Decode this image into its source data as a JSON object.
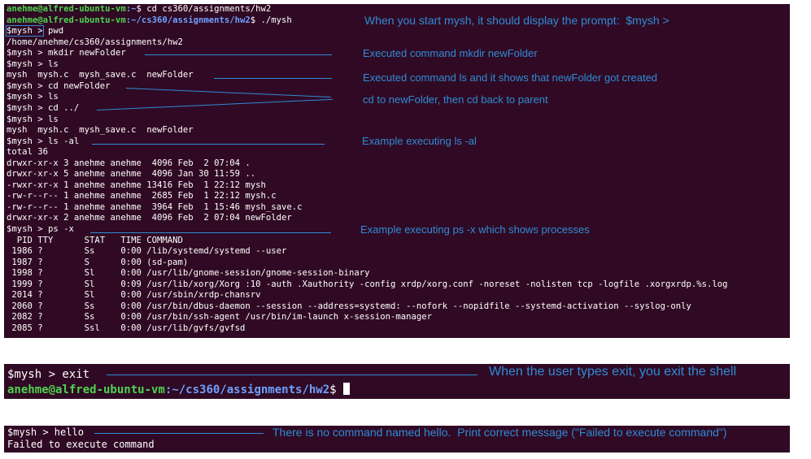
{
  "terminal1": {
    "title_user": "anehme@alfred-ubuntu-vm",
    "title_path": ":~",
    "title_cmd": "$ cd cs360/assignments/hw2",
    "line2_path": ":~/cs360/assignments/hw2",
    "line2_cmd": "$ ./mysh",
    "prompt": "$mysh >",
    "lines": [
      " pwd",
      "/home/anehme/cs360/assignments/hw2",
      "$mysh > mkdir newFolder",
      "$mysh > ls",
      "mysh  mysh.c  mysh_save.c  newFolder",
      "$mysh > cd newFolder",
      "$mysh > ls",
      "$mysh > cd ../",
      "$mysh > ls",
      "mysh  mysh.c  mysh_save.c  newFolder",
      "$mysh > ls -al",
      "total 36",
      "drwxr-xr-x 3 anehme anehme  4096 Feb  2 07:04 .",
      "drwxr-xr-x 5 anehme anehme  4096 Jan 30 11:59 ..",
      "-rwxr-xr-x 1 anehme anehme 13416 Feb  1 22:12 mysh",
      "-rw-r--r-- 1 anehme anehme  2685 Feb  1 22:12 mysh.c",
      "-rw-r--r-- 1 anehme anehme  3964 Feb  1 15:46 mysh_save.c",
      "drwxr-xr-x 2 anehme anehme  4096 Feb  2 07:04 newFolder",
      "$mysh > ps -x",
      "  PID TTY      STAT   TIME COMMAND",
      " 1986 ?        Ss     0:00 /lib/systemd/systemd --user",
      " 1987 ?        S      0:00 (sd-pam)",
      " 1998 ?        Sl     0:00 /usr/lib/gnome-session/gnome-session-binary",
      " 1999 ?        Sl     0:09 /usr/lib/xorg/Xorg :10 -auth .Xauthority -config xrdp/xorg.conf -noreset -nolisten tcp -logfile .xorgxrdp.%s.log",
      " 2014 ?        Sl     0:00 /usr/sbin/xrdp-chansrv",
      " 2060 ?        Ss     0:00 /usr/bin/dbus-daemon --session --address=systemd: --nofork --nopidfile --systemd-activation --syslog-only",
      " 2082 ?        Ss     0:00 /usr/bin/ssh-agent /usr/bin/im-launch x-session-manager",
      " 2085 ?        Ssl    0:00 /usr/lib/gvfs/gvfsd"
    ]
  },
  "annotations": {
    "prompt_note": "When you start mysh, it should display the prompt:  $mysh >",
    "mkdir_note": "Executed command mkdir newFolder",
    "ls_note": "Executed command ls and it shows that newFolder got created",
    "cd_note": "cd to newFolder, then cd back to parent",
    "lsal_note": "Example executing ls -al",
    "ps_note": "Example executing ps -x which shows processes",
    "exit_note": "When the user types exit, you exit the shell",
    "hello_note": "There is no command named hello.  Print correct message (\"Failed to execute command\")"
  },
  "terminal2": {
    "cmd": "$mysh > exit",
    "user": "anehme@alfred-ubuntu-vm",
    "path": ":~/cs360/assignments/hw2",
    "dollar": "$ "
  },
  "terminal3": {
    "cmd": "$mysh > hello",
    "output": "Failed to execute command"
  },
  "colors": {
    "terminal_bg": "#300a24",
    "user_green": "#4fd24f",
    "path_blue": "#6fa0ff",
    "annotation_blue": "#2f8bd6"
  }
}
